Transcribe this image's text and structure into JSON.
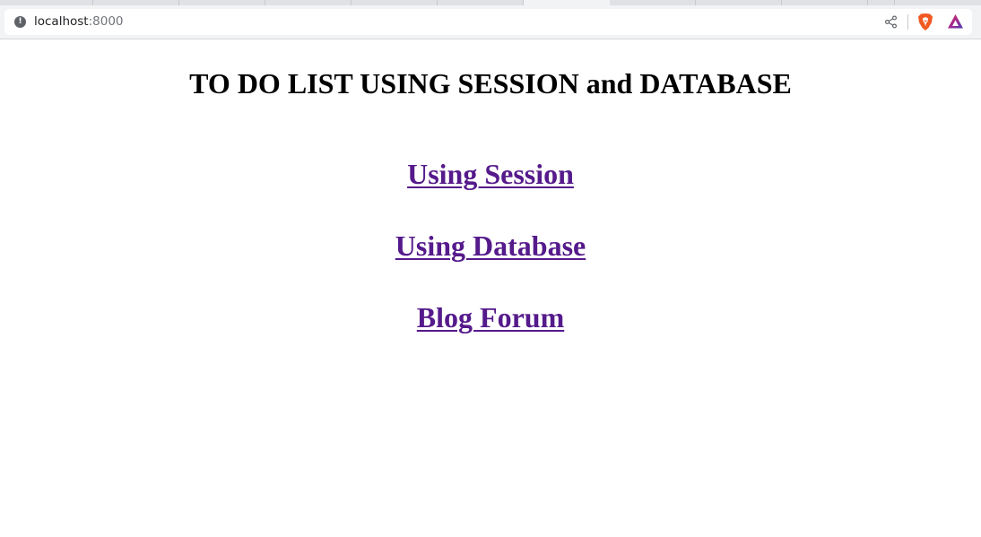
{
  "browser": {
    "address_bar": {
      "host": "localhost",
      "port": ":8000"
    },
    "icons": [
      "info-icon",
      "share-icon",
      "brave-shields-icon",
      "brave-rewards-icon"
    ]
  },
  "page": {
    "title": "TO DO LIST USING SESSION and DATABASE",
    "links": [
      {
        "label": "Using Session"
      },
      {
        "label": "Using Database"
      },
      {
        "label": "Blog Forum"
      }
    ],
    "colors": {
      "link_visited": "#551a8b",
      "title": "#000000"
    }
  }
}
